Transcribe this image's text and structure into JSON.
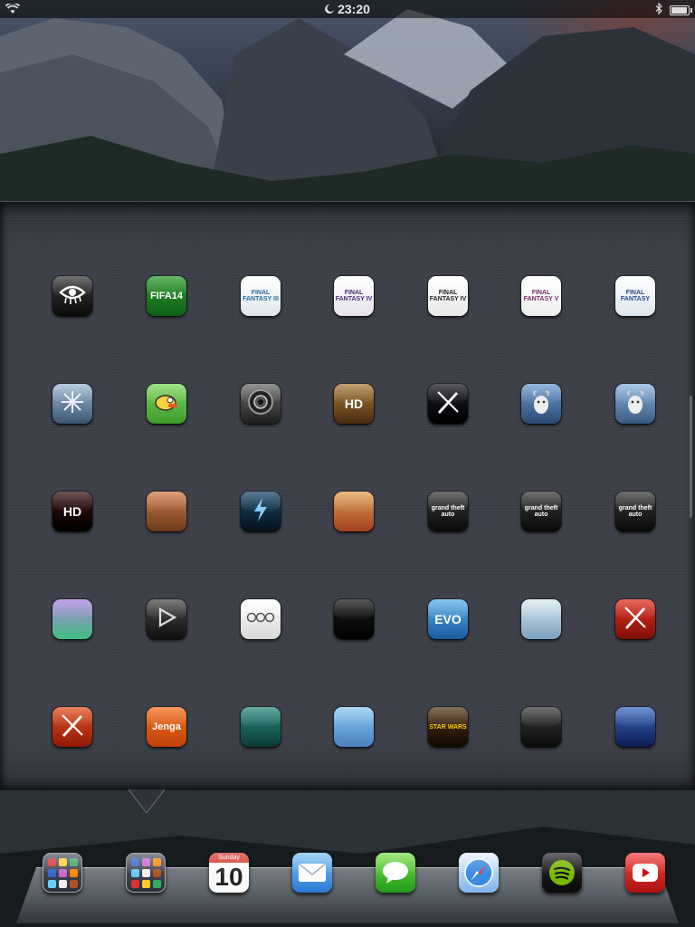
{
  "status_bar": {
    "time": "23:20",
    "icons": [
      "wifi-icon",
      "moon-icon",
      "bluetooth-icon",
      "battery-icon"
    ]
  },
  "folder": {
    "apps": [
      {
        "name": "app-eyes",
        "bg": "linear-gradient(180deg,#3a3a3a,#0a0a0a)",
        "fg": "#fff",
        "label": "",
        "symbol": "eye"
      },
      {
        "name": "app-fifa-14",
        "bg": "linear-gradient(180deg,#2f9a2c,#0c5f17)",
        "fg": "#fff",
        "label": "FIFA14",
        "symbol": ""
      },
      {
        "name": "app-final-fantasy-iii",
        "bg": "linear-gradient(180deg,#ffffff,#dfe6ee)",
        "fg": "#2a6aa0",
        "label": "FINAL FANTASY III",
        "symbol": ""
      },
      {
        "name": "app-final-fantasy-iv",
        "bg": "linear-gradient(180deg,#ffffff,#e6e2ee)",
        "fg": "#4a2a7a",
        "label": "FINAL FANTASY IV",
        "symbol": ""
      },
      {
        "name": "app-final-fantasy-iv-after-years",
        "bg": "linear-gradient(180deg,#ffffff,#e8e8e8)",
        "fg": "#222",
        "label": "FINAL FANTASY IV",
        "symbol": ""
      },
      {
        "name": "app-final-fantasy-v",
        "bg": "linear-gradient(180deg,#ffffff,#eeeeee)",
        "fg": "#7a2a6a",
        "label": "FINAL FANTASY V",
        "symbol": ""
      },
      {
        "name": "app-final-fantasy-dimensions",
        "bg": "linear-gradient(180deg,#ffffff,#dde6f0)",
        "fg": "#2a4a8a",
        "label": "FINAL FANTASY",
        "symbol": ""
      },
      {
        "name": "app-frost-rune",
        "bg": "linear-gradient(180deg,#9ab8d0,#3a5570)",
        "fg": "#fff",
        "label": "",
        "symbol": "snow"
      },
      {
        "name": "app-flappy-bird",
        "bg": "linear-gradient(180deg,#7ad35a,#3e9c2c)",
        "fg": "#fff",
        "label": "",
        "symbol": "bird"
      },
      {
        "name": "app-the-room",
        "bg": "linear-gradient(180deg,#6a6a6a,#1e1e1e)",
        "fg": "#ccc",
        "label": "",
        "symbol": "lens"
      },
      {
        "name": "app-fruit-ninja-hd",
        "bg": "linear-gradient(180deg,#a87a3a,#4a2a10)",
        "fg": "#fff",
        "label": "HD",
        "symbol": ""
      },
      {
        "name": "app-hero-blade",
        "bg": "linear-gradient(180deg,#1a1a2a,#000000)",
        "fg": "#6ad",
        "label": "",
        "symbol": "blade"
      },
      {
        "name": "app-goat-simulator",
        "bg": "linear-gradient(180deg,#6a9ad0,#2a4a70)",
        "fg": "#fff",
        "label": "",
        "symbol": "goat"
      },
      {
        "name": "app-goat-simulator-goatz",
        "bg": "linear-gradient(180deg,#8ab4e0,#3a5a80)",
        "fg": "#fff",
        "label": "",
        "symbol": "goat"
      },
      {
        "name": "app-galaxy-on-fire-hd",
        "bg": "linear-gradient(180deg,#3a1010,#000000)",
        "fg": "#fff",
        "label": "HD",
        "symbol": ""
      },
      {
        "name": "app-warrior-game",
        "bg": "linear-gradient(180deg,#d07a4a,#6a3a1a)",
        "fg": "#fff",
        "label": "",
        "symbol": ""
      },
      {
        "name": "app-storm-game",
        "bg": "linear-gradient(180deg,#1a4a6a,#05101a)",
        "fg": "#7af",
        "label": "",
        "symbol": "bolt"
      },
      {
        "name": "app-street-fighter",
        "bg": "linear-gradient(180deg,#e0a050,#a04020)",
        "fg": "#fff",
        "label": "",
        "symbol": ""
      },
      {
        "name": "app-gta-iii",
        "bg": "linear-gradient(180deg,#3a3a3a,#080808)",
        "fg": "#fff",
        "label": "grand theft auto",
        "symbol": ""
      },
      {
        "name": "app-gta-san-andreas",
        "bg": "linear-gradient(180deg,#3a3a3a,#080808)",
        "fg": "#fff",
        "label": "grand theft auto",
        "symbol": ""
      },
      {
        "name": "app-gta-vice-city",
        "bg": "linear-gradient(180deg,#3a3a3a,#080808)",
        "fg": "#fff",
        "label": "grand theft auto",
        "symbol": ""
      },
      {
        "name": "app-block-game",
        "bg": "linear-gradient(180deg,#b080e0,#40c080)",
        "fg": "#fff",
        "label": "",
        "symbol": ""
      },
      {
        "name": "app-infuse",
        "bg": "linear-gradient(180deg,#4a4a4a,#0e0e0e)",
        "fg": "#ddd",
        "label": "",
        "symbol": "play"
      },
      {
        "name": "app-ooo",
        "bg": "linear-gradient(180deg,#ffffff,#d8d8d8)",
        "fg": "#555",
        "label": "",
        "symbol": "ooo"
      },
      {
        "name": "app-harn",
        "bg": "linear-gradient(180deg,#1a1a1a,#000000)",
        "fg": "#4ad",
        "label": "",
        "symbol": ""
      },
      {
        "name": "app-hungry-shark-evo",
        "bg": "linear-gradient(180deg,#5ab0e8,#1a5aa0)",
        "fg": "#fff",
        "label": "EVO",
        "symbol": ""
      },
      {
        "name": "app-jetpack-game",
        "bg": "linear-gradient(180deg,#d8e8f0,#7aa0c0)",
        "fg": "#333",
        "label": "",
        "symbol": ""
      },
      {
        "name": "app-infinity-blade",
        "bg": "linear-gradient(180deg,#e03020,#801008)",
        "fg": "#fff",
        "label": "",
        "symbol": "blade"
      },
      {
        "name": "app-infinity-blade-ii",
        "bg": "linear-gradient(180deg,#e05020,#901808)",
        "fg": "#fff",
        "label": "",
        "symbol": "blade"
      },
      {
        "name": "app-jenga",
        "bg": "linear-gradient(180deg,#f07020,#c04008)",
        "fg": "#fff",
        "label": "Jenga",
        "symbol": ""
      },
      {
        "name": "app-lost-winds",
        "bg": "linear-gradient(180deg,#2a8a80,#0a3a34)",
        "fg": "#fff",
        "label": "",
        "symbol": ""
      },
      {
        "name": "app-cupcake-game",
        "bg": "linear-gradient(180deg,#8ac8f0,#4a80c0)",
        "fg": "#fff",
        "label": "",
        "symbol": ""
      },
      {
        "name": "app-star-wars",
        "bg": "linear-gradient(180deg,#5a3a1a,#100800)",
        "fg": "#fc0",
        "label": "STAR WARS",
        "symbol": ""
      },
      {
        "name": "app-limbo",
        "bg": "linear-gradient(180deg,#3a3a3a,#0a0a0a)",
        "fg": "#ddd",
        "label": "",
        "symbol": ""
      },
      {
        "name": "app-lego-batman",
        "bg": "linear-gradient(180deg,#3a6ac0,#0a1a50)",
        "fg": "#fff",
        "label": "",
        "symbol": ""
      }
    ]
  },
  "dock": {
    "items": [
      {
        "name": "dock-folder-1",
        "type": "folder"
      },
      {
        "name": "dock-folder-2",
        "type": "folder"
      },
      {
        "name": "dock-calendar",
        "type": "calendar",
        "day": "Sunday",
        "date": "10"
      },
      {
        "name": "dock-mail",
        "type": "mail"
      },
      {
        "name": "dock-messages",
        "type": "messages"
      },
      {
        "name": "dock-safari",
        "type": "safari"
      },
      {
        "name": "dock-spotify",
        "type": "spotify"
      },
      {
        "name": "dock-youtube",
        "type": "youtube"
      }
    ]
  },
  "colors": {
    "accent_red": "#d23a2e",
    "linen": "#3a3d47"
  }
}
